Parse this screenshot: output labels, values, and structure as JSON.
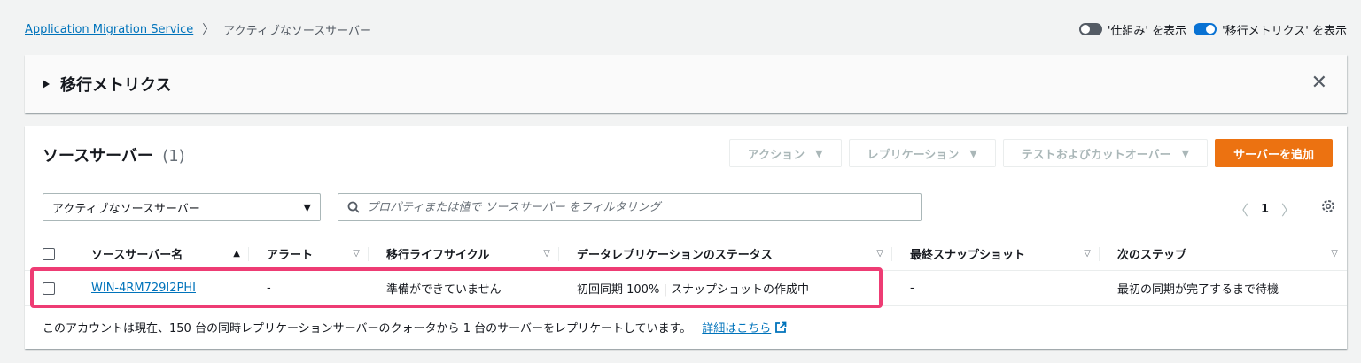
{
  "breadcrumb": {
    "root": "Application Migration Service",
    "separator": "〉",
    "current": "アクティブなソースサーバー"
  },
  "toggles": {
    "how_it_works": "'仕組み' を表示",
    "metrics": "'移行メトリクス' を表示"
  },
  "metrics_panel": {
    "title": "移行メトリクス",
    "close": "✕"
  },
  "servers_panel": {
    "title": "ソースサーバー",
    "count": "(1)",
    "buttons": {
      "actions": "アクション",
      "replication": "レプリケーション",
      "test_cutover": "テストおよびカットオーバー",
      "add_server": "サーバーを追加"
    },
    "filter_select": "アクティブなソースサーバー",
    "filter_placeholder": "プロパティまたは値で ソースサーバー をフィルタリング",
    "page": "1",
    "columns": {
      "name": "ソースサーバー名",
      "alert": "アラート",
      "lifecycle": "移行ライフサイクル",
      "replication_status": "データレプリケーションのステータス",
      "last_snapshot": "最終スナップショット",
      "next_step": "次のステップ"
    },
    "rows": [
      {
        "name": "WIN-4RM729I2PHI",
        "alert": "-",
        "lifecycle": "準備ができていません",
        "replication_status": "初回同期 100% | スナップショットの作成中",
        "last_snapshot": "-",
        "next_step": "最初の同期が完了するまで待機"
      }
    ],
    "footer_text": "このアカウントは現在、150 台の同時レプリケーションサーバーのクォータから 1 台のサーバーをレプリケートしています。",
    "footer_link": "詳細はこちら"
  },
  "colors": {
    "link": "#0073bb",
    "primary_button": "#ec7211",
    "highlight": "#ee3c74",
    "toggle_on": "#0972d3"
  }
}
